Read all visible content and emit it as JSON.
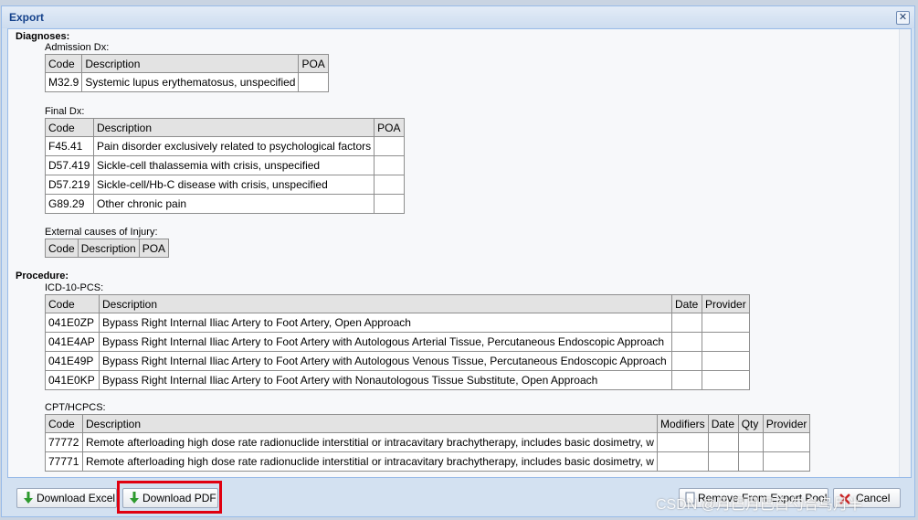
{
  "window": {
    "title": "Export",
    "close_glyph": "✕"
  },
  "diagnoses": {
    "heading": "Diagnoses:",
    "admission": {
      "label": "Admission Dx:",
      "headers": [
        "Code",
        "Description",
        "POA"
      ],
      "rows": [
        [
          "M32.9",
          "Systemic lupus erythematosus, unspecified",
          ""
        ]
      ]
    },
    "final": {
      "label": "Final Dx:",
      "headers": [
        "Code",
        "Description",
        "POA"
      ],
      "rows": [
        [
          "F45.41",
          "Pain disorder exclusively related to psychological factors",
          ""
        ],
        [
          "D57.419",
          "Sickle-cell thalassemia with crisis, unspecified",
          ""
        ],
        [
          "D57.219",
          "Sickle-cell/Hb-C disease with crisis, unspecified",
          ""
        ],
        [
          "G89.29",
          "Other chronic pain",
          ""
        ]
      ]
    },
    "external": {
      "label": "External causes of Injury:",
      "headers": [
        "Code",
        "Description",
        "POA"
      ],
      "rows": []
    }
  },
  "procedure": {
    "heading": "Procedure:",
    "icd10pcs": {
      "label": "ICD-10-PCS:",
      "headers": [
        "Code",
        "Description",
        "Date",
        "Provider"
      ],
      "rows": [
        [
          "041E0ZP",
          "Bypass Right Internal Iliac Artery to Foot Artery, Open Approach",
          "",
          ""
        ],
        [
          "041E4AP",
          "Bypass Right Internal Iliac Artery to Foot Artery with Autologous Arterial Tissue, Percutaneous Endoscopic Approach",
          "",
          ""
        ],
        [
          "041E49P",
          "Bypass Right Internal Iliac Artery to Foot Artery with Autologous Venous Tissue, Percutaneous Endoscopic Approach",
          "",
          ""
        ],
        [
          "041E0KP",
          "Bypass Right Internal Iliac Artery to Foot Artery with Nonautologous Tissue Substitute, Open Approach",
          "",
          ""
        ]
      ]
    },
    "cpt": {
      "label": "CPT/HCPCS:",
      "headers": [
        "Code",
        "Description",
        "Modifiers",
        "Date",
        "Qty",
        "Provider"
      ],
      "rows": [
        [
          "77772",
          "Remote afterloading high dose rate radionuclide interstitial or intracavitary brachytherapy, includes basic dosimetry, w",
          "",
          "",
          "",
          ""
        ],
        [
          "77771",
          "Remote afterloading high dose rate radionuclide interstitial or intracavitary brachytherapy, includes basic dosimetry, w",
          "",
          "",
          "",
          ""
        ]
      ]
    }
  },
  "footer": {
    "download_excel": "Download Excel",
    "download_pdf": "Download PDF",
    "remove_from_pool": "Remove From Export Pool",
    "cancel": "Cancel"
  },
  "watermark": "CSDN @月巴月巴白勺合鸟月半",
  "colors": {
    "highlight": "#e00010",
    "title": "#15428b",
    "download_arrow": "#2e9a2e",
    "cancel_x": "#cc2020"
  }
}
